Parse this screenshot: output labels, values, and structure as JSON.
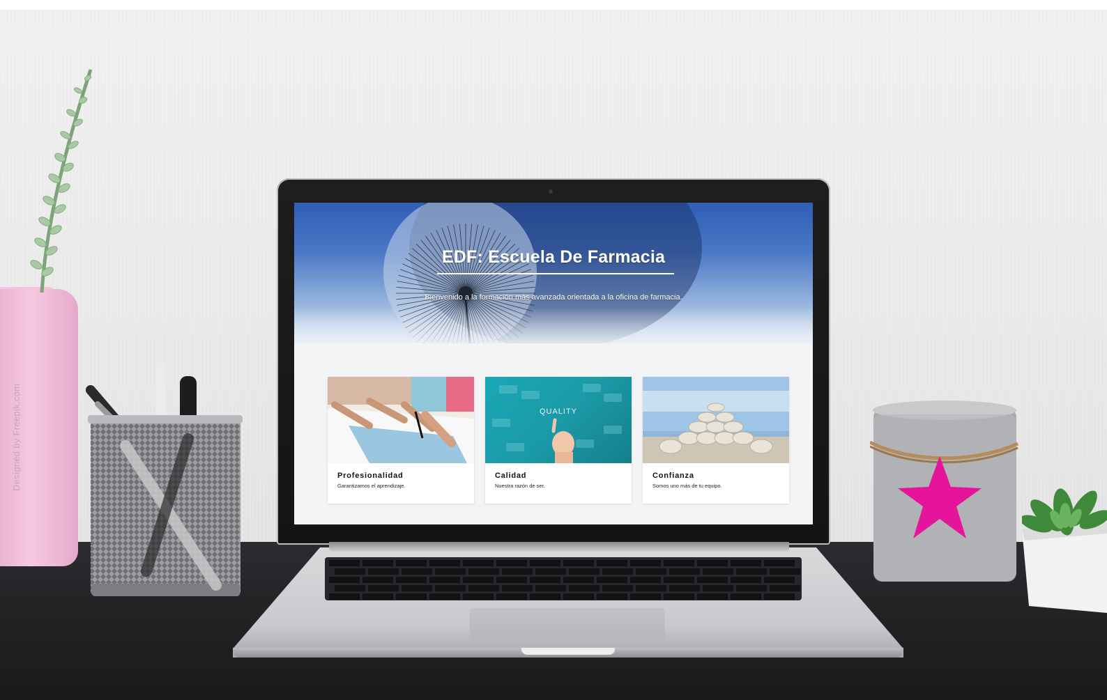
{
  "hero": {
    "title": "EDF: Escuela De Farmacia",
    "subtitle": "Bienvenido a la formación más avanzada orientada a la oficina de farmacia."
  },
  "cards": [
    {
      "title": "Profesionalidad",
      "text": "Garantizamos el aprendizaje."
    },
    {
      "title": "Calidad",
      "text": "Nuestra razón de ser.",
      "image_label": "QUALITY"
    },
    {
      "title": "Confianza",
      "text": "Somos uno más de tu equipo."
    }
  ],
  "watermark": "Designed by Freepik.com",
  "colors": {
    "hero_blue": "#2f5eb6",
    "star_magenta": "#e5149a",
    "vase_pink": "#f3c2dd",
    "desk": "#232326"
  }
}
